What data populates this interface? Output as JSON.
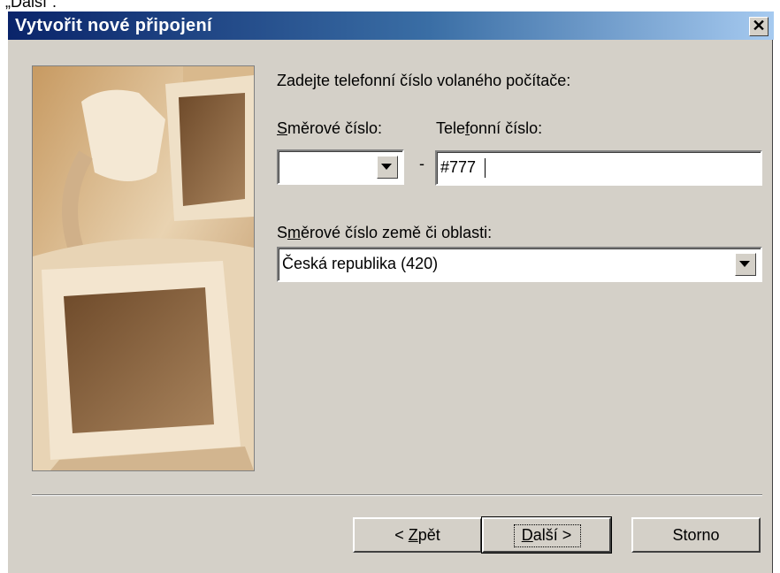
{
  "caption_fragment": "„Další“.",
  "window": {
    "title": "Vytvořit nové připojení",
    "close_glyph": "✕"
  },
  "prompt": "Zadejte telefonní číslo volaného počítače:",
  "area_code": {
    "label_u": "S",
    "label_rest": "měrové číslo:",
    "value": ""
  },
  "dash": "-",
  "phone": {
    "label_a": "Tele",
    "label_u": "f",
    "label_b": "onní číslo:",
    "value": "#777"
  },
  "country": {
    "label_a": "S",
    "label_u": "m",
    "label_b": "ěrové číslo země či oblasti:",
    "value": "Česká republika (420)"
  },
  "buttons": {
    "back": {
      "prefix": "< ",
      "u": "Z",
      "rest": "pět"
    },
    "next": {
      "u": "D",
      "rest": "alší >"
    },
    "cancel": "Storno"
  }
}
